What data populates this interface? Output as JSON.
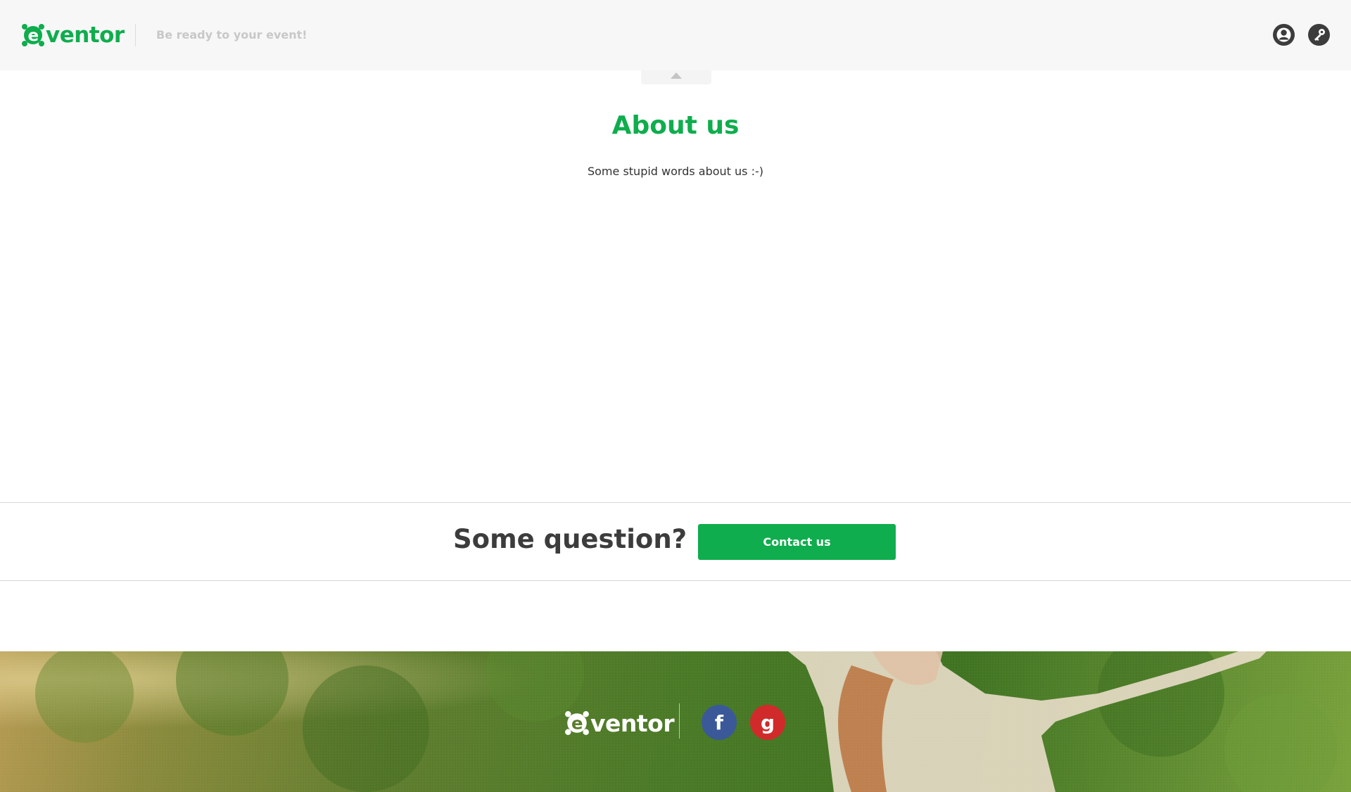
{
  "header": {
    "logo_text": "ventor",
    "tagline": "Be ready to your event!",
    "user_icon": "user-icon",
    "key_icon": "key-icon"
  },
  "about": {
    "title": "About us",
    "text": "Some stupid words about us :-)"
  },
  "question": {
    "text": "Some question?",
    "button_label": "Contact us"
  },
  "footer": {
    "logo_text": "ventor",
    "facebook_label": "f",
    "google_label": "g"
  },
  "colors": {
    "brand_green": "#0fad4d",
    "header_bg": "#f7f7f7",
    "facebook": "#3b5998",
    "google": "#d12a2a"
  }
}
